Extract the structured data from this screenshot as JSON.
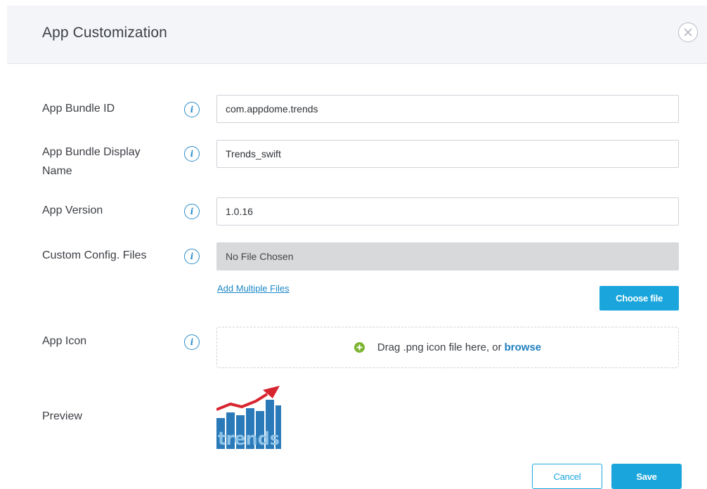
{
  "dialog": {
    "title": "App Customization",
    "close_icon": "close-icon"
  },
  "form": {
    "bundle_id": {
      "label": "App Bundle ID",
      "value": "com.appdome.trends",
      "info_icon": "info-icon"
    },
    "display_name": {
      "label": "App Bundle Display Name",
      "value": "Trends_swift",
      "info_icon": "info-icon"
    },
    "version": {
      "label": "App Version",
      "value": "1.0.16",
      "info_icon": "info-icon"
    },
    "config_files": {
      "label": "Custom Config. Files",
      "value": "No File Chosen",
      "add_multiple_link": "Add Multiple Files",
      "choose_button": "Choose file",
      "info_icon": "info-icon"
    },
    "app_icon": {
      "label": "App Icon",
      "drop_text": "Drag .png icon file here, or",
      "browse_link": "browse",
      "plus_icon": "plus-circle-icon",
      "info_icon": "info-icon"
    },
    "preview": {
      "label": "Preview",
      "image_text": "trends",
      "image_icon": "trends-app-icon"
    }
  },
  "footer": {
    "cancel_label": "Cancel",
    "save_label": "Save"
  },
  "colors": {
    "accent": "#1aa6dc",
    "link": "#1e88c7",
    "header_bg": "#f3f5f8",
    "plus_green": "#7bb32e",
    "preview_blue": "#2a79b8",
    "preview_red": "#d7252f"
  }
}
